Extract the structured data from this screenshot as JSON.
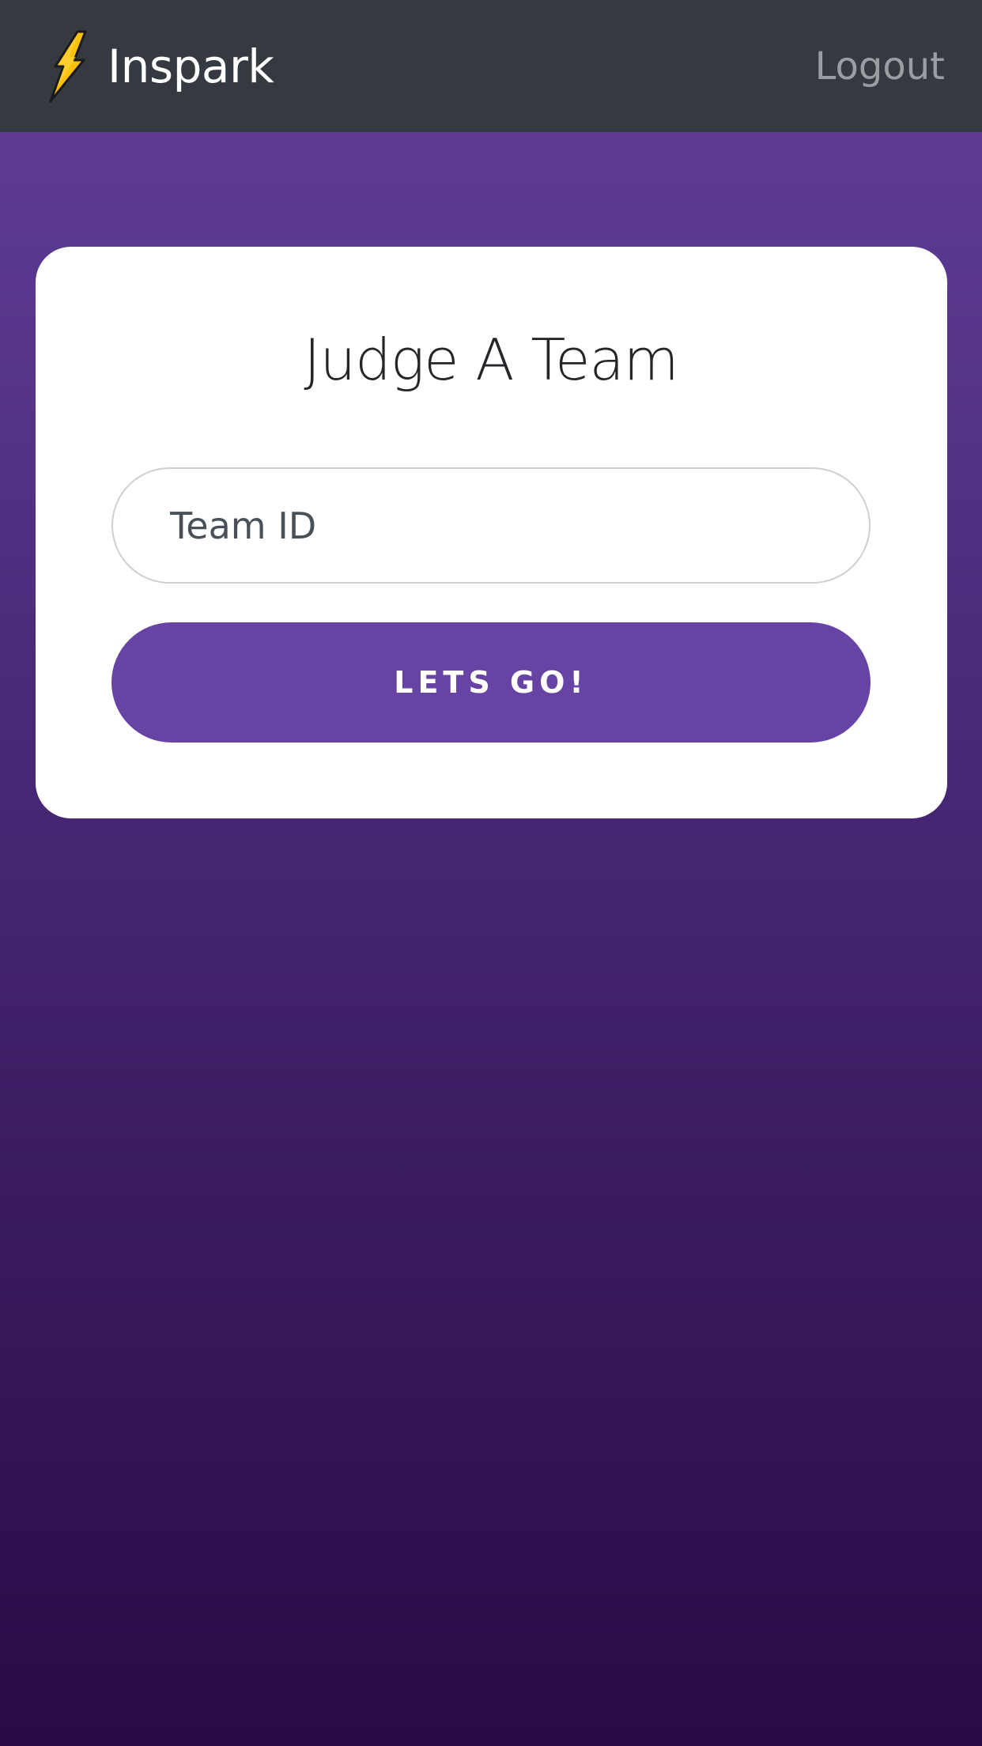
{
  "navbar": {
    "brand_name": "Inspark",
    "brand_icon": "lightning-bolt-icon",
    "logout_label": "Logout"
  },
  "card": {
    "title": "Judge A Team",
    "team_id_placeholder": "Team ID",
    "team_id_value": "",
    "submit_label": "LETS GO!"
  },
  "colors": {
    "navbar_bg": "#343a40",
    "accent": "#6743a3",
    "bolt_fill": "#ffc107",
    "gradient_top": "#643f9c",
    "gradient_bottom": "#2b0a46"
  }
}
